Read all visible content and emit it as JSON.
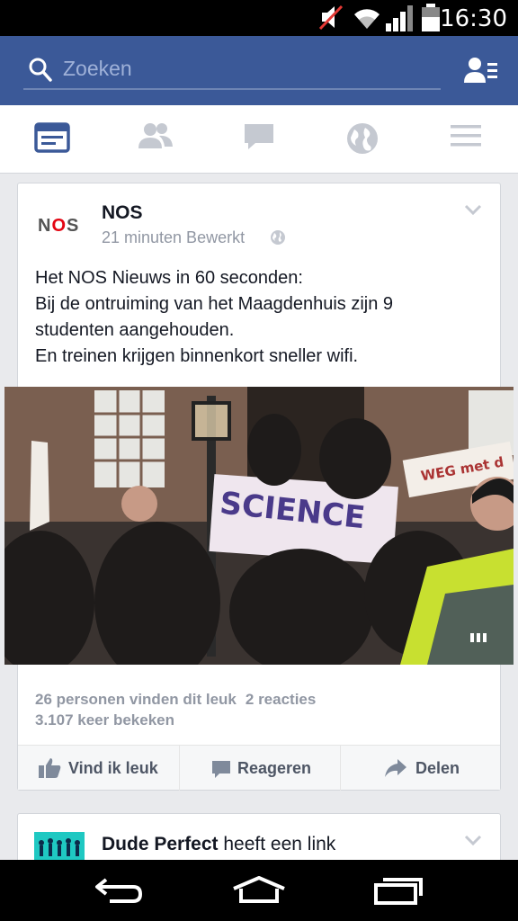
{
  "status_bar": {
    "time": "16:30",
    "icons": [
      "mute-icon",
      "wifi-icon",
      "signal-icon",
      "battery-icon"
    ]
  },
  "search": {
    "placeholder": "Zoeken",
    "friend_requests_icon": "friend-requests-icon"
  },
  "tabs": [
    {
      "name": "news-feed",
      "icon": "newsfeed-icon",
      "active": true
    },
    {
      "name": "friend-requests",
      "icon": "friends-icon",
      "active": false
    },
    {
      "name": "messages",
      "icon": "chat-icon",
      "active": false
    },
    {
      "name": "notifications",
      "icon": "globe-icon",
      "active": false
    },
    {
      "name": "more",
      "icon": "menu-icon",
      "active": false
    }
  ],
  "post": {
    "logo": {
      "pre": "N",
      "mid": "O",
      "post": "S"
    },
    "author": "NOS",
    "meta": "21 minuten Bewerkt",
    "text_lines": [
      "Het NOS Nieuws in 60 seconden:",
      "Bij de ontruiming van het Maagdenhuis zijn 9",
      "studenten aangehouden.",
      "En treinen krijgen binnenkort sneller wifi."
    ],
    "banner_text": "SCIENCE",
    "banner2_text": "WEG met d",
    "likes": "26 personen vinden dit leuk",
    "comments": "2 reacties",
    "views": "3.107 keer bekeken",
    "actions": {
      "like": "Vind ik leuk",
      "comment": "Reageren",
      "share": "Delen"
    }
  },
  "post2": {
    "author": "Dude Perfect",
    "rest": " heeft een link"
  },
  "colors": {
    "brand": "#3b5998",
    "nos_red": "#e30613",
    "muted": "#9197a3"
  }
}
